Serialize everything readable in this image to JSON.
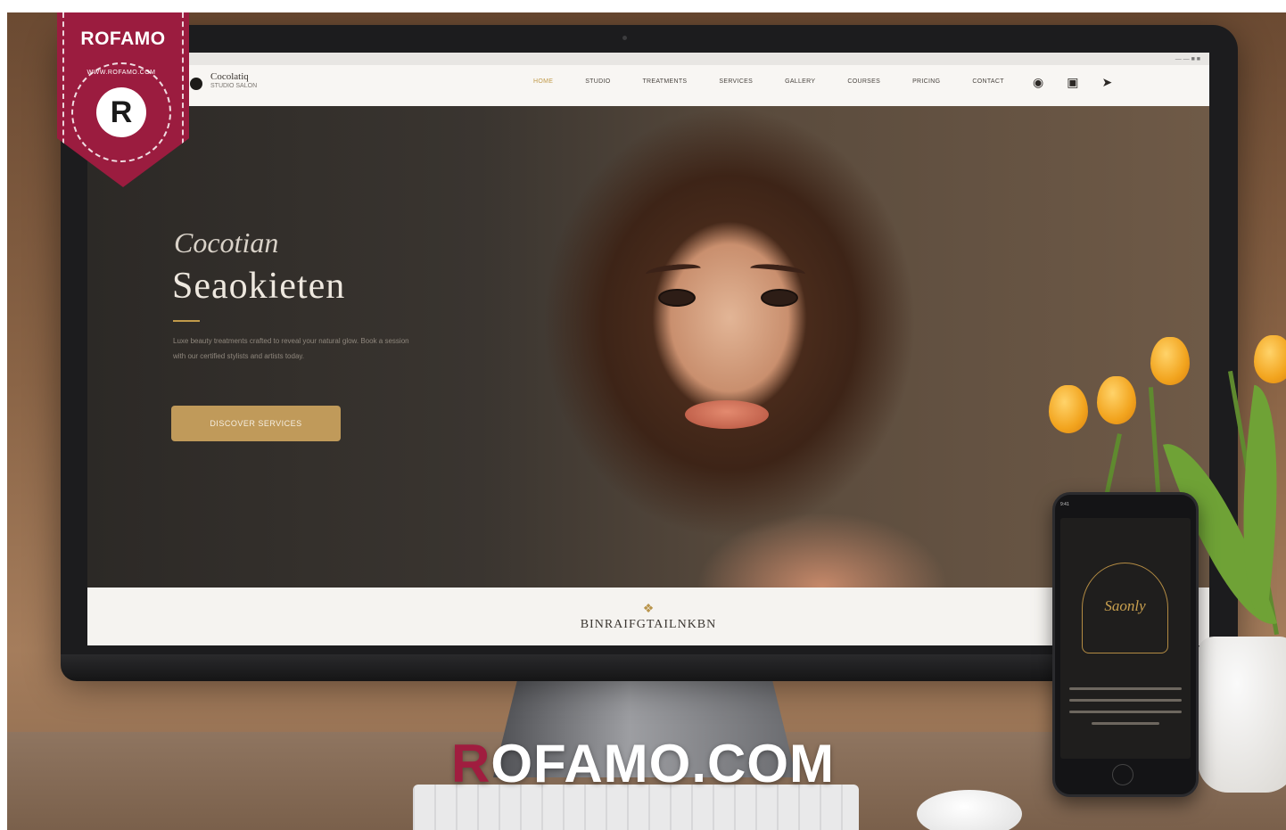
{
  "browser": {
    "bar_left": "■ ■ ■",
    "bar_right": "— — ■ ■"
  },
  "site": {
    "logo_title": "Cocolatiq",
    "logo_subtitle": "STUDIO SALON",
    "nav": [
      "HOME",
      "STUDIO",
      "TREATMENTS",
      "SERVICES",
      "GALLERY",
      "COURSES",
      "PRICING",
      "CONTACT"
    ],
    "nav_icons": [
      "chat-icon",
      "calendar-icon",
      "share-icon"
    ],
    "hero_script": "Cocotian",
    "hero_title": "Seaokieten",
    "hero_copy": "Luxe beauty treatments crafted to reveal your natural glow. Book a session with our certified stylists and artists today.",
    "hero_button": "DISCOVER SERVICES",
    "footer_ornament": "❖",
    "footer_text": "BINRAIFGTAILNKBN"
  },
  "phone": {
    "status": "9:41",
    "logo_text": "Saonly"
  },
  "watermark": {
    "badge_name": "ROFAMO",
    "badge_ring": "WWW.ROFAMO.COM",
    "badge_core": "R",
    "big_r": "R",
    "big_rest": "OFAMO.COM"
  },
  "colors": {
    "accent_gold": "#c09a5a",
    "brand_maroon": "#9b1c3f"
  }
}
